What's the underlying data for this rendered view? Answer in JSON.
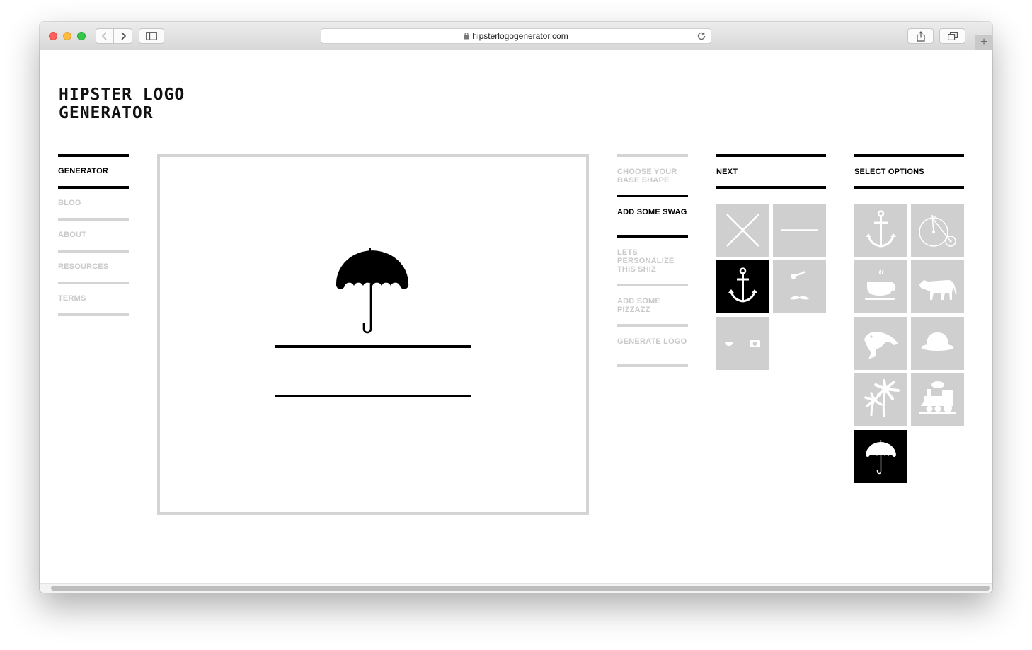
{
  "browser": {
    "url": "hipsterlogogenerator.com"
  },
  "site": {
    "logo_line1": "HIPSTER LOGO",
    "logo_line2": "GENERATOR"
  },
  "nav": {
    "items": [
      {
        "label": "GENERATOR",
        "active": true
      },
      {
        "label": "BLOG",
        "active": false
      },
      {
        "label": "ABOUT",
        "active": false
      },
      {
        "label": "RESOURCES",
        "active": false
      },
      {
        "label": "TERMS",
        "active": false
      }
    ]
  },
  "canvas": {
    "icon": "umbrella-icon"
  },
  "steps": {
    "items": [
      {
        "label": "CHOOSE YOUR BASE SHAPE",
        "active": false
      },
      {
        "label": "ADD SOME SWAG",
        "active": true
      },
      {
        "label": "LETS PERSONALIZE THIS SHIZ",
        "active": false
      },
      {
        "label": "ADD SOME PIZZAZZ",
        "active": false
      },
      {
        "label": "GENERATE LOGO",
        "active": false
      }
    ]
  },
  "next_panel": {
    "title": "NEXT",
    "tiles": [
      {
        "icon": "x-lines-icon",
        "selected": false
      },
      {
        "icon": "single-line-icon",
        "selected": false
      },
      {
        "icon": "anchor-icon",
        "selected": true
      },
      {
        "icon": "pipe-mustache-icon",
        "selected": false
      },
      {
        "icon": "cup-camera-icon",
        "selected": false
      }
    ]
  },
  "options_panel": {
    "title": "SELECT OPTIONS",
    "tiles": [
      {
        "icon": "anchor-icon",
        "selected": false
      },
      {
        "icon": "penny-farthing-icon",
        "selected": false
      },
      {
        "icon": "coffee-cup-icon",
        "selected": false
      },
      {
        "icon": "cow-icon",
        "selected": false
      },
      {
        "icon": "fish-icon",
        "selected": false
      },
      {
        "icon": "bowler-hat-icon",
        "selected": false
      },
      {
        "icon": "palm-trees-icon",
        "selected": false
      },
      {
        "icon": "train-icon",
        "selected": false
      },
      {
        "icon": "umbrella-icon",
        "selected": true
      }
    ]
  },
  "colors": {
    "accent": "#000000",
    "inactive": "#d4d4d4",
    "tile": "#cfcfcf"
  }
}
